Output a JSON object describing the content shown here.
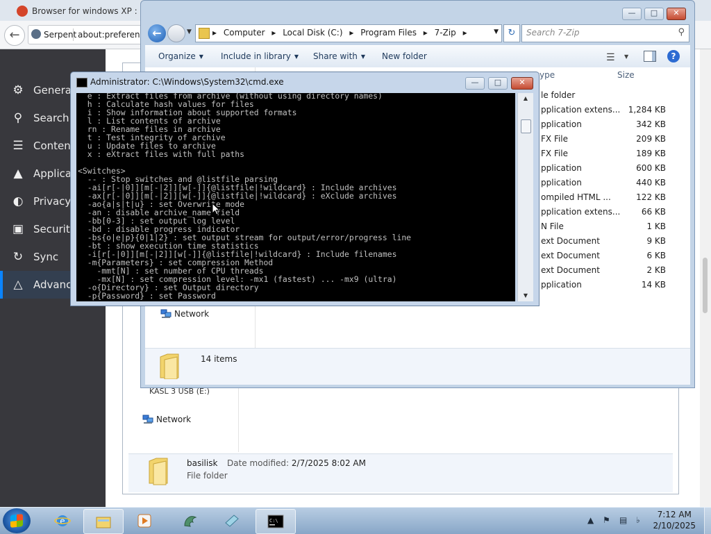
{
  "browser": {
    "title": "Browser for windows XP : (",
    "site_label": "Serpent",
    "address": "about:preference",
    "back_glyph": "←",
    "sidebar": [
      {
        "label": "General",
        "icon": "gear-icon",
        "glyph": "⚙"
      },
      {
        "label": "Search",
        "icon": "search-icon",
        "glyph": "⚲"
      },
      {
        "label": "Content",
        "icon": "document-icon",
        "glyph": "☰"
      },
      {
        "label": "Applica",
        "icon": "rocket-icon",
        "glyph": "▲"
      },
      {
        "label": "Privacy",
        "icon": "mask-icon",
        "glyph": "◐"
      },
      {
        "label": "Security",
        "icon": "lock-icon",
        "glyph": "▣"
      },
      {
        "label": "Sync",
        "icon": "sync-icon",
        "glyph": "↻"
      },
      {
        "label": "Advance",
        "icon": "wizard-hat-icon",
        "glyph": "△"
      }
    ]
  },
  "explorer_back": {
    "usb_label": "KASL 3 USB (E:)",
    "network_label": "Network",
    "selected_name": "basilisk",
    "date_modified_label": "Date modified:",
    "date_modified_value": "2/7/2025 8:02 AM",
    "selected_type": "File folder"
  },
  "explorer": {
    "breadcrumb": [
      "Computer",
      "Local Disk (C:)",
      "Program Files",
      "7-Zip"
    ],
    "search_placeholder": "Search 7-Zip",
    "commands": [
      "Organize",
      "Include in library",
      "Share with",
      "New folder"
    ],
    "columns": {
      "type": "ype",
      "size": "Size"
    },
    "rows": [
      {
        "type": "le folder",
        "size": ""
      },
      {
        "type": "pplication extens...",
        "size": "1,284 KB"
      },
      {
        "type": "pplication",
        "size": "342 KB"
      },
      {
        "type": "FX File",
        "size": "209 KB"
      },
      {
        "type": "FX File",
        "size": "189 KB"
      },
      {
        "type": "pplication",
        "size": "600 KB"
      },
      {
        "type": "pplication",
        "size": "440 KB"
      },
      {
        "type": "ompiled HTML ...",
        "size": "122 KB"
      },
      {
        "type": "pplication extens...",
        "size": "66 KB"
      },
      {
        "type": "N File",
        "size": "1 KB"
      },
      {
        "type": "ext Document",
        "size": "9 KB"
      },
      {
        "type": "ext Document",
        "size": "6 KB"
      },
      {
        "type": "ext Document",
        "size": "2 KB"
      },
      {
        "type": "pplication",
        "size": "14 KB"
      }
    ],
    "network_label": "Network",
    "item_count": "14 items",
    "controls": {
      "minimize": "—",
      "maximize": "□",
      "close": "✕"
    }
  },
  "cmd": {
    "title": "Administrator: C:\\Windows\\System32\\cmd.exe",
    "lines": [
      "  e : Extract files from archive (without using directory names)",
      "  h : Calculate hash values for files",
      "  i : Show information about supported formats",
      "  l : List contents of archive",
      "  rn : Rename files in archive",
      "  t : Test integrity of archive",
      "  u : Update files to archive",
      "  x : eXtract files with full paths",
      "",
      "<Switches>",
      "  -- : Stop switches and @listfile parsing",
      "  -ai[r[-|0]][m[-|2]][w[-]]{@listfile|!wildcard} : Include archives",
      "  -ax[r[-|0]][m[-|2]][w[-]]{@listfile|!wildcard} : eXclude archives",
      "  -ao{a|s|t|u} : set Overwrite mode",
      "  -an : disable archive_name field",
      "  -bb[0-3] : set output log level",
      "  -bd : disable progress indicator",
      "  -bs{o|e|p}{0|1|2} : set output stream for output/error/progress line",
      "  -bt : show execution time statistics",
      "  -i[r[-|0]][m[-|2]][w[-]]{@listfile|!wildcard} : Include filenames",
      "  -m{Parameters} : set compression Method",
      "    -mmt[N] : set number of CPU threads",
      "    -mx[N] : set compression level: -mx1 (fastest) ... -mx9 (ultra)",
      "  -o{Directory} : set Output directory",
      "  -p{Password} : set Password"
    ]
  },
  "taskbar": {
    "time": "7:12 AM",
    "date": "2/10/2025",
    "apps": [
      "internet-explorer",
      "file-explorer",
      "media-player",
      "basilisk",
      "notepad",
      "cmd"
    ]
  }
}
